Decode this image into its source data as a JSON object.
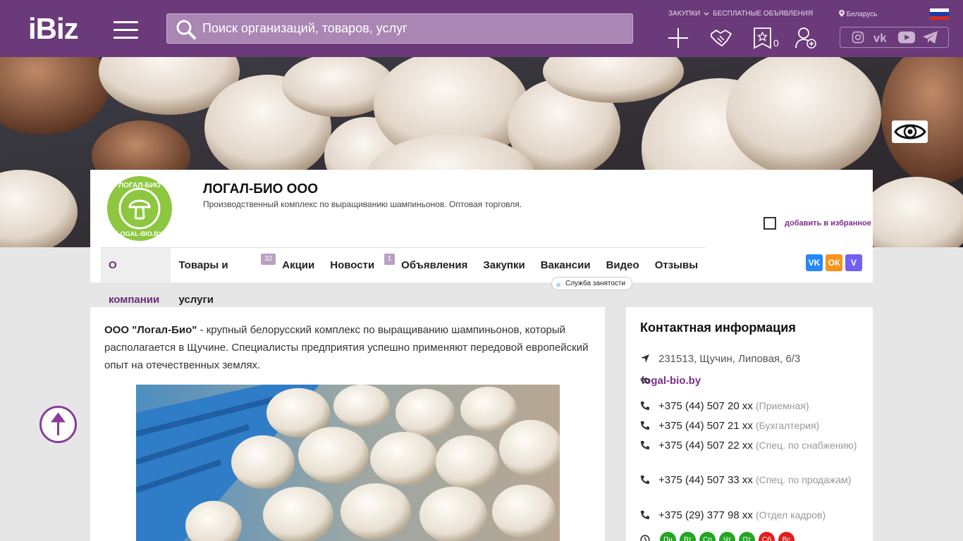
{
  "header": {
    "logo": "iBiz",
    "search_placeholder": "Поиск организаций, товаров, услуг",
    "links": [
      "ЗАКУПКИ",
      "БЕСПЛАТНЫЕ ОБЪЯВЛЕНИЯ"
    ],
    "region": "Беларусь",
    "favorites_count": "0",
    "icons": [
      "plus-icon",
      "handshake-icon",
      "star-favorites-icon",
      "add-user-icon"
    ],
    "social": [
      "instagram-icon",
      "vk-icon",
      "youtube-icon",
      "telegram-icon"
    ]
  },
  "company": {
    "name": "ЛОГАЛ-БИО ООО",
    "description": "Производственный комплекс по выращиванию шампиньонов. Оптовая торговля.",
    "add_favorite": "добавить в избранное",
    "logo_text": "ЛОГАЛ-БИО LOGAL-BIO.BY"
  },
  "nav": {
    "tabs": [
      {
        "label": "О компании",
        "active": true
      },
      {
        "label": "Товары и услуги",
        "badge": "32"
      },
      {
        "label": "Акции"
      },
      {
        "label": "Новости",
        "badge": "1"
      },
      {
        "label": "Объявления"
      },
      {
        "label": "Закупки"
      },
      {
        "label": "Вакансии"
      },
      {
        "label": "Видео"
      },
      {
        "label": "Отзывы"
      }
    ],
    "employment": "Служба занятости"
  },
  "share": [
    {
      "name": "vk",
      "color": "#2787f5",
      "label": "VK"
    },
    {
      "name": "ok",
      "color": "#f7931e",
      "label": "ОК"
    },
    {
      "name": "viber",
      "color": "#7360f2",
      "label": "V"
    }
  ],
  "about": {
    "company_quote": "ООО \"Логал-Био\"",
    "text": " - крупный белорусский комплекс по выращиванию шампиньонов, который располагается в Щучине.  Специалисты предприятия успешно применяют передовой европейский опыт на отечественных землях."
  },
  "contact": {
    "title": "Контактная информация",
    "address": "231513, Щучин, Липовая, 6/3",
    "website": "logal-bio.by",
    "phones": [
      {
        "number": "+375 (44) 507 20 xx",
        "note": "(Приемная)"
      },
      {
        "number": "+375 (44) 507 21 xx",
        "note": "(Бухгалтерия)"
      },
      {
        "number": "+375 (44) 507 22 xx",
        "note": "(Спец. по снабжению)"
      },
      {
        "number": "+375 (44) 507 33 xx",
        "note": "(Спец. по продажам)"
      },
      {
        "number": "+375 (29) 377 98 xx",
        "note": "(Отдел кадров)"
      }
    ],
    "days": [
      {
        "label": "Пн",
        "color": "#22a522"
      },
      {
        "label": "Вт",
        "color": "#22a522"
      },
      {
        "label": "Ср",
        "color": "#22a522"
      },
      {
        "label": "Чт",
        "color": "#22a522"
      },
      {
        "label": "Пт",
        "color": "#22a522"
      },
      {
        "label": "Сб",
        "color": "#e01f1f"
      },
      {
        "label": "Вс",
        "color": "#e01f1f"
      }
    ]
  },
  "colors": {
    "brand": "#6b3a7a",
    "accent": "#7b2f8c",
    "logo_green": "#8dc63f"
  }
}
